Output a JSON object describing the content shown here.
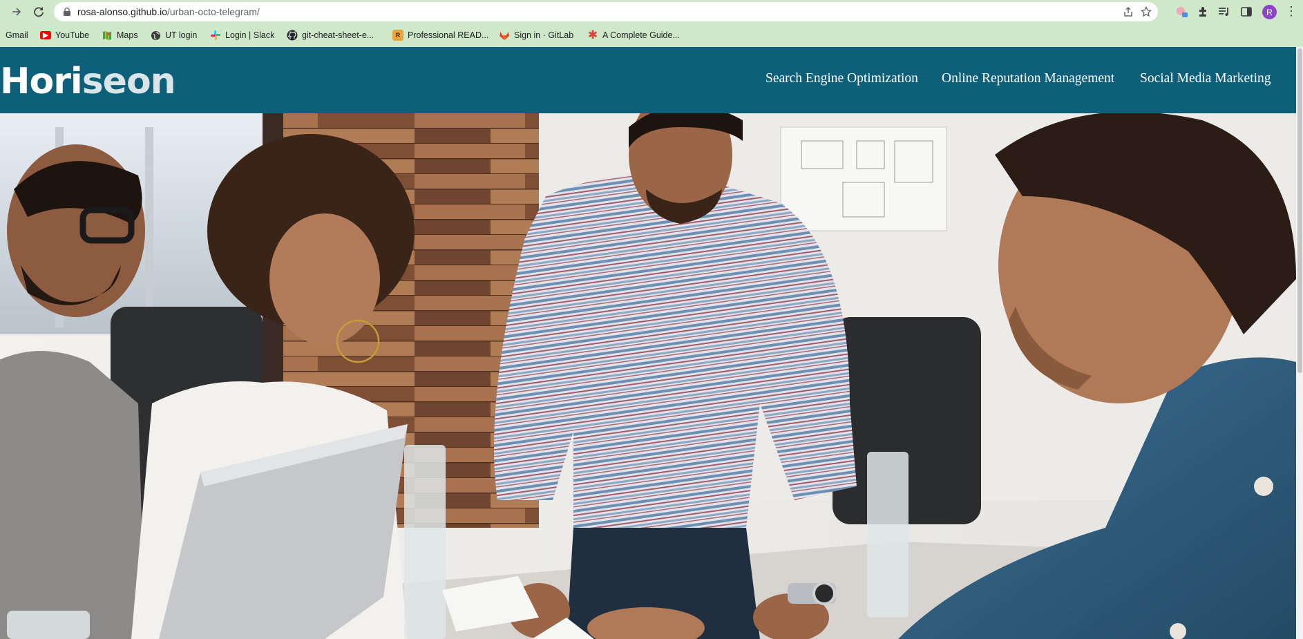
{
  "browser": {
    "url_host": "rosa-alonso.github.io",
    "url_path": "/urban-octo-telegram/",
    "profile_initial": "R",
    "bookmarks": [
      {
        "label": "Gmail",
        "icon": "gmail-icon"
      },
      {
        "label": "YouTube",
        "icon": "youtube-icon"
      },
      {
        "label": "Maps",
        "icon": "maps-icon"
      },
      {
        "label": "UT login",
        "icon": "globe-icon"
      },
      {
        "label": "Login | Slack",
        "icon": "slack-icon"
      },
      {
        "label": "git-cheat-sheet-e...",
        "icon": "github-icon"
      },
      {
        "label": "Professional READ...",
        "icon": "readme-icon"
      },
      {
        "label": "Sign in · GitLab",
        "icon": "gitlab-icon"
      },
      {
        "label": "A Complete Guide...",
        "icon": "asterisk-icon"
      }
    ]
  },
  "site": {
    "logo_main": "Hori",
    "logo_accent": "seon",
    "nav": [
      "Search Engine Optimization",
      "Online Reputation Management",
      "Social Media Marketing"
    ],
    "hero_image": "team-meeting-photo"
  },
  "colors": {
    "header_bg": "#0d5f7a",
    "chrome_bg": "#cfe8c9"
  }
}
